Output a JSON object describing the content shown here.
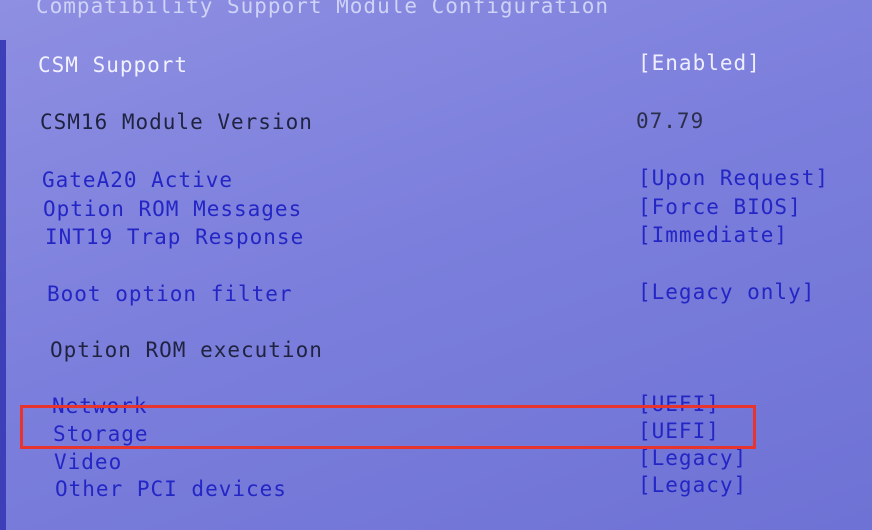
{
  "title": "Compatibility Support Module Configuration",
  "items": [
    {
      "label": "CSM Support",
      "value": "[Enabled]"
    },
    {
      "label": "CSM16 Module Version",
      "value": "07.79"
    },
    {
      "label": "GateA20 Active",
      "value": "[Upon Request]"
    },
    {
      "label": "Option ROM Messages",
      "value": "[Force BIOS]"
    },
    {
      "label": "INT19 Trap Response",
      "value": "[Immediate]"
    },
    {
      "label": "Boot option filter",
      "value": "[Legacy only]"
    },
    {
      "label": "Option ROM execution"
    },
    {
      "label": "Network",
      "value": "[UEFI]"
    },
    {
      "label": "Storage",
      "value": "[UEFI]"
    },
    {
      "label": "Video",
      "value": "[Legacy]"
    },
    {
      "label": "Other PCI devices",
      "value": "[Legacy]"
    }
  ],
  "highlight_color": "#e8342f",
  "background_color": "#7c7fdc"
}
